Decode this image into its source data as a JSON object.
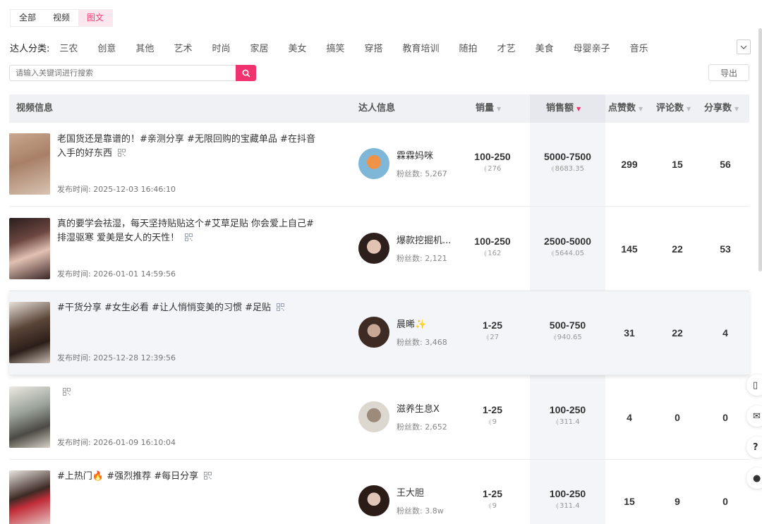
{
  "tabs": [
    "全部",
    "视频",
    "图文"
  ],
  "active_tab": 2,
  "category_label": "达人分类:",
  "categories": [
    "三农",
    "创意",
    "其他",
    "艺术",
    "时尚",
    "家居",
    "美女",
    "搞笑",
    "穿搭",
    "教育培训",
    "随拍",
    "才艺",
    "美食",
    "母婴亲子",
    "音乐"
  ],
  "search": {
    "placeholder": "请输入关键词进行搜索"
  },
  "export_label": "导出",
  "table": {
    "headers": {
      "video": "视频信息",
      "kol": "达人信息",
      "sales": "销量",
      "sales_amount": "销售额",
      "likes": "点赞数",
      "comments": "评论数",
      "shares": "分享数"
    },
    "rows": [
      {
        "title": "老国货还是靠谱的！#亲测分享 #无限回购的宝藏单品 #在抖音入手的好东西",
        "publish": "发布时间: 2025-12-03 16:46:10",
        "kol_name": "霖霖妈咪",
        "fans": "粉丝数: 5,267",
        "sales_range": "100-250",
        "sales_value": "276",
        "amount_range": "5000-7500",
        "amount_value": "8683.35",
        "likes": "299",
        "comments": "15",
        "shares": "56"
      },
      {
        "title": "真的要学会祛湿，每天坚持贴贴这个#艾草足贴 你会爱上自己# 排湿驱寒 爱美是女人的天性！",
        "publish": "发布时间: 2026-01-01 14:59:56",
        "kol_name": "爆款挖掘机...",
        "fans": "粉丝数: 2,121",
        "sales_range": "100-250",
        "sales_value": "162",
        "amount_range": "2500-5000",
        "amount_value": "5644.05",
        "likes": "145",
        "comments": "22",
        "shares": "53"
      },
      {
        "title": "#干货分享 #女生必看 #让人悄悄变美的习惯 #足贴",
        "publish": "发布时间: 2025-12-28 12:39:56",
        "kol_name": "晨晞✨",
        "fans": "粉丝数: 3,468",
        "sales_range": "1-25",
        "sales_value": "27",
        "amount_range": "500-750",
        "amount_value": "940.65",
        "likes": "31",
        "comments": "22",
        "shares": "4"
      },
      {
        "title": "",
        "publish": "发布时间: 2026-01-09 16:10:04",
        "kol_name": "滋养生息X",
        "fans": "粉丝数: 2,652",
        "sales_range": "1-25",
        "sales_value": "9",
        "amount_range": "100-250",
        "amount_value": "311.4",
        "likes": "4",
        "comments": "0",
        "shares": "0"
      },
      {
        "title": "#上热门🔥 #强烈推荐 #每日分享",
        "publish": "",
        "kol_name": "王大胆",
        "fans": "粉丝数: 3.8w",
        "sales_range": "1-25",
        "sales_value": "9",
        "amount_range": "100-250",
        "amount_value": "311.4",
        "likes": "15",
        "comments": "9",
        "shares": "0"
      }
    ]
  },
  "side_buttons": [
    "phone-icon",
    "mail-icon",
    "?",
    "wechat-icon"
  ],
  "colors": {
    "accent": "#f0336f",
    "tab_active_bg": "#fde7ef",
    "header_bg": "#f0f1f4"
  }
}
